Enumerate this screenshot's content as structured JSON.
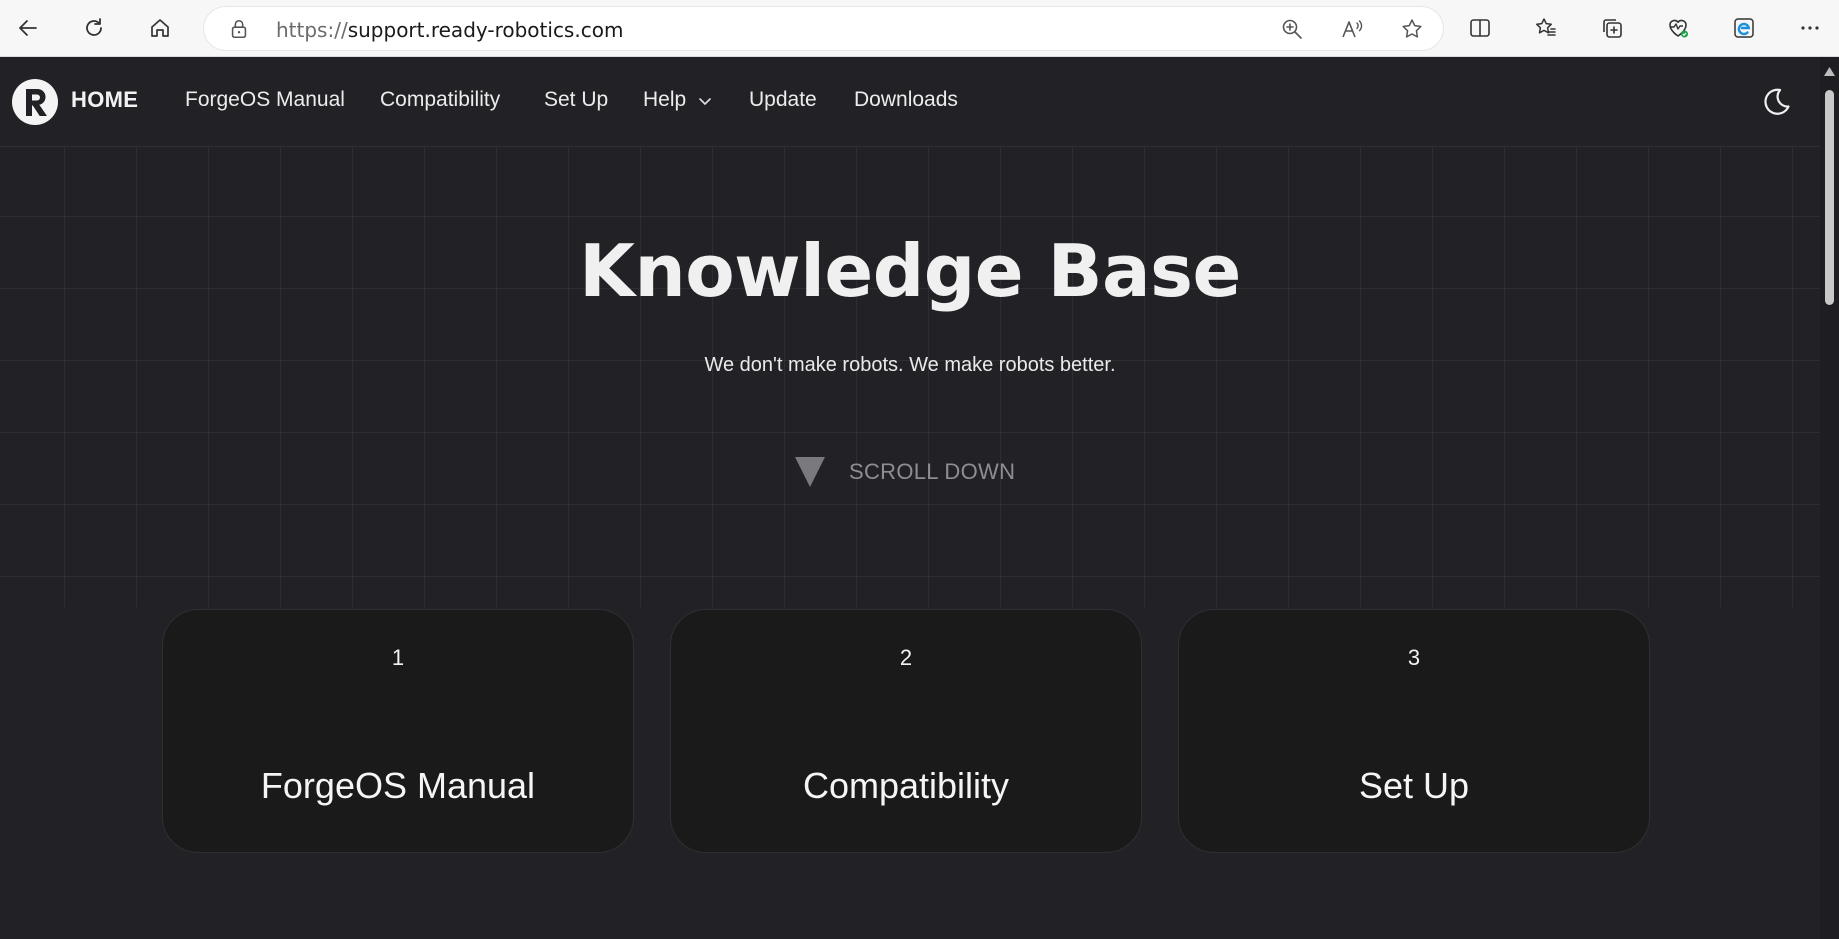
{
  "browser": {
    "url_protocol": "https://",
    "url_host": "support.ready-robotics.com"
  },
  "nav": {
    "home_label": "HOME",
    "items": [
      {
        "label": "ForgeOS Manual"
      },
      {
        "label": "Compatibility"
      },
      {
        "label": "Set Up"
      },
      {
        "label": "Help"
      },
      {
        "label": "Update"
      },
      {
        "label": "Downloads"
      }
    ]
  },
  "hero": {
    "title": "Knowledge Base",
    "subtitle": "We don't make robots. We make robots better.",
    "scroll_label": "SCROLL DOWN"
  },
  "cards": [
    {
      "number": "1",
      "title": "ForgeOS Manual"
    },
    {
      "number": "2",
      "title": "Compatibility"
    },
    {
      "number": "3",
      "title": "Set Up"
    }
  ],
  "colors": {
    "page_bg": "#222226",
    "card_bg": "#1a1a1a",
    "text": "#f0f0f0",
    "muted": "#8e8e92"
  },
  "icons": [
    "back-icon",
    "refresh-icon",
    "home-icon",
    "lock-icon",
    "zoom-icon",
    "read-aloud-icon",
    "favorite-star-icon",
    "split-screen-icon",
    "favorites-icon",
    "collections-icon",
    "browser-essentials-icon",
    "copilot-icon",
    "more-icon",
    "chevron-down-icon",
    "moon-icon",
    "triangle-down-icon"
  ]
}
